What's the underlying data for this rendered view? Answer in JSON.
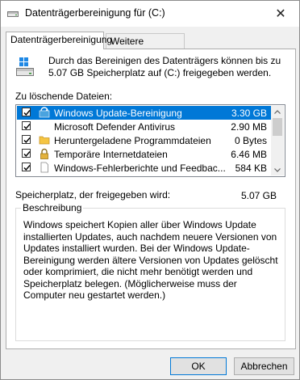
{
  "window": {
    "title": "Datenträgerbereinigung für  (C:)",
    "close_glyph": "✕"
  },
  "tabs": [
    {
      "label": "Datenträgerbereinigung",
      "active": true
    },
    {
      "label": "Weitere Optionen",
      "active": false
    }
  ],
  "header": {
    "icon": "drive-icon",
    "description": "Durch das Bereinigen des Datenträgers können bis zu 5.07 GB Speicherplatz auf  (C:) freigegeben werden."
  },
  "files": {
    "label": "Zu löschende Dateien:",
    "items": [
      {
        "name": "Windows Update-Bereinigung",
        "size": "3.30 GB",
        "checked": true,
        "selected": true,
        "icon": "windows-update-icon"
      },
      {
        "name": "Microsoft Defender Antivirus",
        "size": "2.90 MB",
        "checked": true,
        "selected": false,
        "icon": "blank-icon"
      },
      {
        "name": "Heruntergeladene Programmdateien",
        "size": "0 Bytes",
        "checked": true,
        "selected": false,
        "icon": "folder-icon"
      },
      {
        "name": "Temporäre Internetdateien",
        "size": "6.46 MB",
        "checked": true,
        "selected": false,
        "icon": "lock-icon"
      },
      {
        "name": "Windows-Fehlerberichte und Feedbac...",
        "size": "584 KB",
        "checked": true,
        "selected": false,
        "icon": "document-icon"
      }
    ]
  },
  "freed": {
    "label": "Speicherplatz, der freigegeben wird:",
    "value": "5.07 GB"
  },
  "description_group": {
    "title": "Beschreibung",
    "text": "Windows speichert Kopien aller über Windows Update installierten Updates, auch nachdem neuere Versionen von Updates installiert wurden. Bei der Windows Update-Bereinigung werden ältere Versionen von Updates gelöscht oder komprimiert, die nicht mehr benötigt werden und Speicherplatz belegen. (Möglicherweise muss der Computer neu gestartet werden.)"
  },
  "buttons": {
    "ok": "OK",
    "cancel": "Abbrechen"
  },
  "colors": {
    "selection": "#0078d7",
    "dialog_bg": "#f0f0f0",
    "panel_bg": "#ffffff"
  }
}
